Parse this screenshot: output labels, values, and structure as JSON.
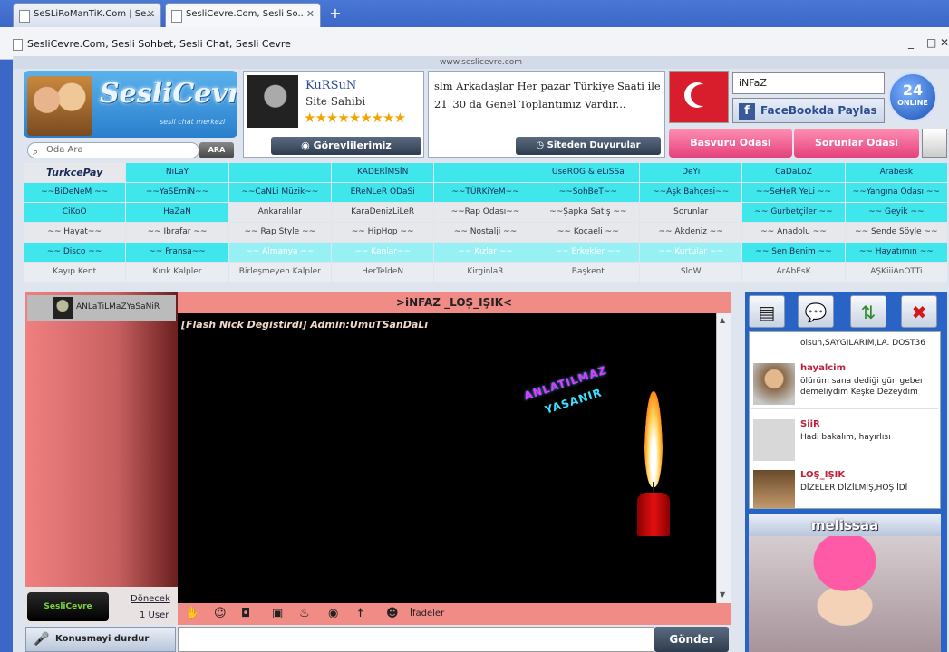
{
  "browser": {
    "tabs": [
      {
        "label": "SeSLiRoManTiK.Com | Se..."
      },
      {
        "label": "SesliCevre.Com, Sesli So..."
      }
    ],
    "window_title": "SesliCevre.Com, Sesli Sohbet, Sesli Chat, Sesli Cevre",
    "page_url": "www.seslicevre.com"
  },
  "header": {
    "brand": "SesliCevre",
    "brand_sub": "sesli chat merkezi",
    "search_placeholder": "Oda Ara",
    "search_button": "ARA",
    "profile": {
      "name": "KuRSuN",
      "role": "Site Sahibi",
      "stars": "★★★★★★★★★",
      "button": "Görevlilerimiz"
    },
    "announcement": {
      "text": "slm Arkadaşlar Her pazar Türkiye Saati ile 21_30 da Genel Toplantımız Vardır...",
      "button": "Siteden Duyurular"
    },
    "user_field": "iNFaZ",
    "facebook_share": "FaceBookda Paylas",
    "online": {
      "count": "24",
      "label": "ONLINE"
    },
    "buttons": {
      "basvuru": "Basvuru Odasi",
      "sorunlar": "Sorunlar Odasi"
    }
  },
  "rooms": [
    [
      "TurkcePay",
      "NiLaY",
      "",
      "KADERİMSİN",
      "",
      "UseROG & eLiSSa",
      "DeYi",
      "CaDaLoZ",
      "Arabesk"
    ],
    [
      "~~BiDeNeM ~~",
      "~~YaSEmiN~~",
      "~~CaNLi Müzik~~",
      "EReNLeR ODaSi",
      "~~TÜRKiYeM~~",
      "~~SohBeT~~",
      "~~Aşk Bahçesi~~",
      "~~SeHeR YeLi ~~",
      "~~Yangına Odası ~~"
    ],
    [
      "CiKoO",
      "HaZaN",
      "Ankaralılar",
      "KaraDenizLiLeR",
      "~~Rap Odası~~",
      "~~Şapka Satış ~~",
      "Sorunlar",
      "~~ Gurbetçiler ~~",
      "~~ Geyik ~~"
    ],
    [
      "~~ Hayat~~",
      "~~ Ibrafar ~~",
      "~~ Rap Style ~~",
      "~~ HipHop ~~",
      "~~ Nostalji ~~",
      "~~ Kocaeli ~~",
      "~~ Akdeniz ~~",
      "~~ Anadolu ~~",
      "~~ Sende Söyle ~~"
    ],
    [
      "~~ Disco ~~",
      "~~ Fransa~~",
      "~~ Almanya ~~",
      "~~ Kanlar~~",
      "~~ Kızlar ~~",
      "~~ Erkekler ~~",
      "~~ Kurtular ~~",
      "~~ Sen Benim ~~",
      "~~ Hayatımın ~~"
    ],
    [
      "Kayıp Kent",
      "Kırık Kalpler",
      "Birleşmeyen Kalpler",
      "HerTeldeN",
      "KirginlaR",
      "Başkent",
      "SloW",
      "ArAbEsK",
      "AŞKiiiAnOTTi"
    ]
  ],
  "chat": {
    "user_name": "ANLaTiLMaZYaSaNiR",
    "room_title": ">iNFAZ _LOŞ_IŞIK<",
    "messages": [
      "[Flash Nick Degistirdi] Admin:UmuTSanDaLı"
    ],
    "art_line1": "ANLATILMAZ",
    "art_line2": "YASANIR",
    "expressions_label": "İfadeler",
    "send_button": "Gönder",
    "stop_talking": "Konusmayi durdur",
    "return_link": "Dönecek",
    "user_count": "1 User",
    "badge": "SesliCevre"
  },
  "feed": {
    "items": [
      {
        "name": "",
        "text": "olsun,SAYGILARIM,LA. DOST36"
      },
      {
        "name": "hayalcim",
        "text": "ölürüm sana dediği gün geber demeliydim Keşke Dezeydim"
      },
      {
        "name": "SiiR",
        "text": "Hadi bakalım, hayırlısı"
      },
      {
        "name": "LOŞ_IŞIK",
        "text": "DİZELER DİZİLMİŞ,HOŞ İDİ"
      }
    ],
    "featured_name": "melissaa"
  },
  "colors": {
    "cyan": "#3fe6ec",
    "pink": "#f08b86",
    "blue": "#2a63c6"
  }
}
